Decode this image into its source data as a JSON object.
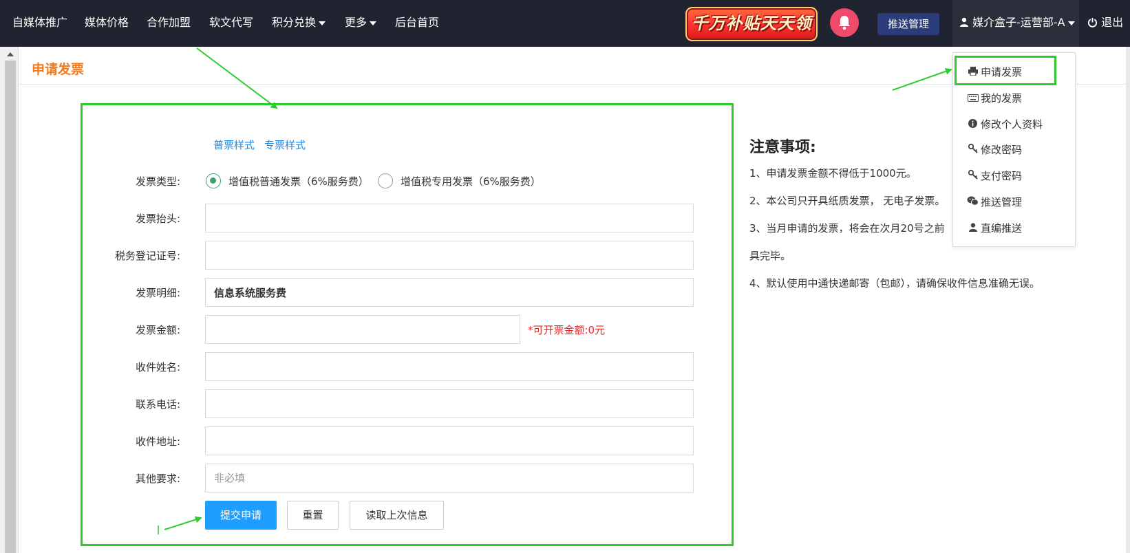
{
  "navbar": {
    "items": [
      "自媒体推广",
      "媒体价格",
      "合作加盟",
      "软文代写",
      "积分兑换",
      "更多",
      "后台首页"
    ],
    "promo_text": "千万补贴天天领",
    "push_button": "推送管理",
    "user_name": "媒介盒子-运营部-A",
    "logout": "退出"
  },
  "page": {
    "title": "申请发票"
  },
  "form": {
    "samples": [
      "普票样式",
      "专票样式"
    ],
    "labels": {
      "invoice_type": "发票类型:",
      "invoice_title": "发票抬头:",
      "tax_id": "税务登记证号:",
      "invoice_detail": "发票明细:",
      "invoice_amount": "发票金额:",
      "recipient_name": "收件姓名:",
      "phone": "联系电话:",
      "address": "收件地址:",
      "other": "其他要求:"
    },
    "invoice_type_options": [
      "增值税普通发票（6%服务费）",
      "增值税专用发票（6%服务费）"
    ],
    "invoice_type_selected": 0,
    "invoice_detail_value": "信息系统服务费",
    "amount_hint": "*可开票金额:0元",
    "other_placeholder": "非必填",
    "buttons": {
      "submit": "提交申请",
      "reset": "重置",
      "load_last": "读取上次信息"
    }
  },
  "notes": {
    "title": "注意事项:",
    "items": [
      "1、申请发票金额不得低于1000元。",
      "2、本公司只开具纸质发票， 无电子发票。",
      "3、当月申请的发票，将会在次月20号之前",
      "具完毕。",
      "4、默认使用中通快递邮寄（包邮），请确保收件信息准确无误。"
    ]
  },
  "dropdown": {
    "items": [
      {
        "label": "申请发票",
        "icon": "printer-icon"
      },
      {
        "label": "我的发票",
        "icon": "keyboard-icon"
      },
      {
        "label": "修改个人资料",
        "icon": "info-icon"
      },
      {
        "label": "修改密码",
        "icon": "key-icon"
      },
      {
        "label": "支付密码",
        "icon": "key-icon"
      },
      {
        "label": "推送管理",
        "icon": "wechat-icon"
      },
      {
        "label": "直编推送",
        "icon": "user-icon"
      }
    ]
  },
  "colors": {
    "navbar_bg": "#1f2430",
    "accent_orange": "#f37b1d",
    "primary_blue": "#1e9fff",
    "link_blue": "#1e88e5",
    "annotation_green": "#2ecc2e",
    "hint_red": "#e52a2a"
  }
}
